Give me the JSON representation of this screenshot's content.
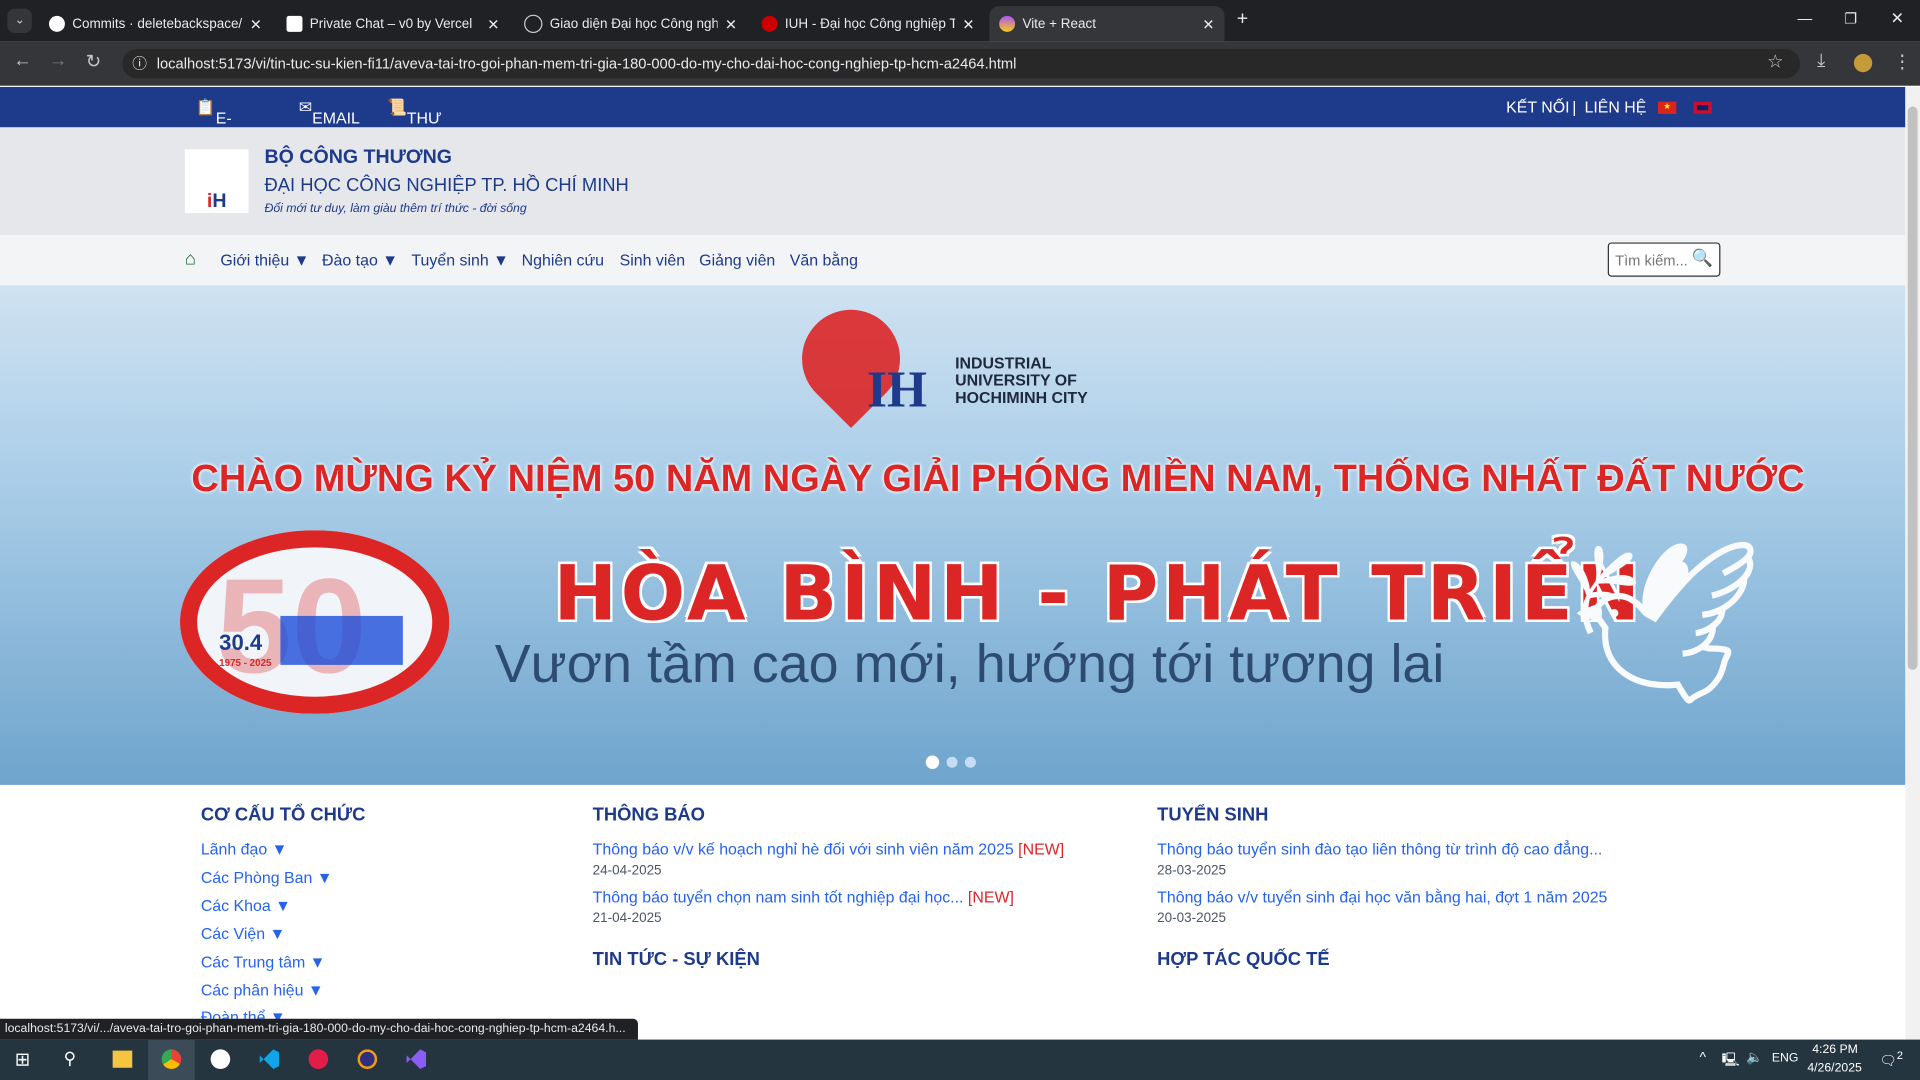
{
  "browser": {
    "tabs": [
      {
        "title": "Commits · deletebackspace/pha",
        "icon": "github-icon"
      },
      {
        "title": "Private Chat – v0 by Vercel",
        "icon": "v0-icon"
      },
      {
        "title": "Giao diện Đại học Công nghiệp",
        "icon": "slash-icon"
      },
      {
        "title": "IUH - Đại học Công nghiệp TP.H",
        "icon": "iuh-icon"
      },
      {
        "title": "Vite + React",
        "icon": "vite-icon"
      }
    ],
    "url": "localhost:5173/vi/tin-tuc-su-kien-fi11/aveva-tai-tro-goi-phan-mem-tri-gia-180-000-do-my-cho-dai-hoc-cong-nghiep-tp-hcm-a2464.html",
    "status_url": "localhost:5173/vi/.../aveva-tai-tro-goi-phan-mem-tri-gia-180-000-do-my-cho-dai-hoc-cong-nghiep-tp-hcm-a2464.h..."
  },
  "topbar": {
    "eoffice": "E-OFFICE",
    "email": "EMAIL",
    "library": "THƯ VIỆN - THÔNG TIN",
    "connect": "KẾT NỐI",
    "sep": "|",
    "contact": "LIÊN HỆ"
  },
  "header": {
    "ministry": "BỘ CÔNG THƯƠNG",
    "university": "ĐẠI HỌC CÔNG NGHIỆP TP. HỒ CHÍ MINH",
    "slogan": "Đổi mới tư duy, làm giàu thêm trí thức - đời sống",
    "logo_text": "IUH"
  },
  "nav": {
    "items": [
      "Giới thiệu ▼",
      "Đào tạo ▼",
      "Tuyển sinh ▼",
      "Nghiên cứu",
      "Sinh viên",
      "Giảng viên",
      "Văn bằng"
    ],
    "search_placeholder": "Tìm kiếm..."
  },
  "banner": {
    "logo_lines": [
      "INDUSTRIAL",
      "UNIVERSITY OF",
      "HOCHIMINH CITY"
    ],
    "headline": "CHÀO MỪNG KỶ NIỆM 50 NĂM NGÀY GIẢI PHÓNG MIỀN NAM, THỐNG NHẤT ĐẤT NƯỚC",
    "title": "HÒA BÌNH - PHÁT TRIỂN",
    "subtitle": "Vươn tầm cao mới, hướng tới tương lai",
    "badge_num": "50",
    "badge_date": "30.4",
    "badge_years": "1975 - 2025",
    "slide_count": 3,
    "active_slide": 1
  },
  "org": {
    "title": "CƠ CẤU TỔ CHỨC",
    "items": [
      "Lãnh đạo ▼",
      "Các Phòng Ban ▼",
      "Các Khoa ▼",
      "Các Viện ▼",
      "Các Trung tâm ▼",
      "Các phân hiệu ▼",
      "Đoàn thể ▼"
    ]
  },
  "notices": {
    "title": "THÔNG BÁO",
    "items": [
      {
        "text": "Thông báo v/v kế hoạch nghỉ hè đối với sinh viên năm 2025",
        "tag": "[NEW]",
        "date": "24-04-2025"
      },
      {
        "text": "Thông báo tuyển chọn nam sinh tốt nghiệp đại học...",
        "tag": "[NEW]",
        "date": "21-04-2025"
      }
    ]
  },
  "admissions": {
    "title": "TUYỂN SINH",
    "items": [
      {
        "text": "Thông báo tuyển sinh đào tạo liên thông từ trình độ cao đẳng...",
        "date": "28-03-2025"
      },
      {
        "text": "Thông báo v/v tuyển sinh đại học văn bằng hai, đợt 1 năm 2025",
        "date": "20-03-2025"
      }
    ]
  },
  "news": {
    "title": "TIN TỨC - SỰ KIỆN"
  },
  "intl": {
    "title": "HỢP TÁC QUỐC TẾ"
  },
  "taskbar": {
    "lang": "ENG",
    "time": "4:26 PM",
    "date": "4/26/2025",
    "notif": "2"
  }
}
